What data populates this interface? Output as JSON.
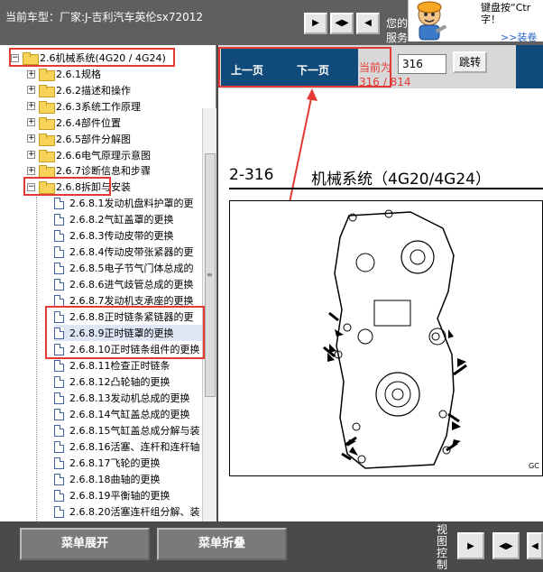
{
  "header": {
    "vehicle_label": "当前车型：厂家:J-吉利汽车英伦sx72012",
    "tip_text": "您的\n服务",
    "hint_text": "键盘按“Ctr\n字！",
    "hint_link": ">>装卷"
  },
  "tree": {
    "root": "2.6机械系统(4G20 / 4G24)",
    "sections": [
      {
        "label": "2.6.1规格"
      },
      {
        "label": "2.6.2描述和操作"
      },
      {
        "label": "2.6.3系统工作原理"
      },
      {
        "label": "2.6.4部件位置"
      },
      {
        "label": "2.6.5部件分解图"
      },
      {
        "label": "2.6.6电气原理示意图"
      },
      {
        "label": "2.6.7诊断信息和步骤"
      },
      {
        "label": "2.6.8拆卸与安装"
      }
    ],
    "items": [
      {
        "label": "2.6.8.1发动机盘料护罩的更"
      },
      {
        "label": "2.6.8.2气缸盖罩的更换"
      },
      {
        "label": "2.6.8.3传动皮带的更换"
      },
      {
        "label": "2.6.8.4传动皮带张紧器的更"
      },
      {
        "label": "2.6.8.5电子节气门体总成的"
      },
      {
        "label": "2.6.8.6进气歧管总成的更换"
      },
      {
        "label": "2.6.8.7发动机支承座的更换"
      },
      {
        "label": "2.6.8.8正时链条紧链器的更"
      },
      {
        "label": "2.6.8.9正时链罩的更换"
      },
      {
        "label": "2.6.8.10正时链条组件的更换"
      },
      {
        "label": "2.6.8.11检查正时链条"
      },
      {
        "label": "2.6.8.12凸轮轴的更换"
      },
      {
        "label": "2.6.8.13发动机总成的更换"
      },
      {
        "label": "2.6.8.14气缸盖总成的更换"
      },
      {
        "label": "2.6.8.15气缸盖总成分解与装"
      },
      {
        "label": "2.6.8.16活塞、连杆和连杆轴"
      },
      {
        "label": "2.6.8.17飞轮的更换"
      },
      {
        "label": "2.6.8.18曲轴的更换"
      },
      {
        "label": "2.6.8.19平衡轴的更换"
      },
      {
        "label": "2.6.8.20活塞连杆组分解、装"
      }
    ],
    "grip": "≡"
  },
  "pager": {
    "prev": "上一页",
    "next": "下一页",
    "current_label": "当前为",
    "current_value": "316 / 814",
    "page_input": "316",
    "goto": "跳转"
  },
  "document": {
    "page_num": "2-316",
    "title": "机械系统（4G20/4G24）",
    "figure_code": "GC"
  },
  "footer": {
    "expand": "菜单展开",
    "collapse": "菜单折叠",
    "view_control": "视图控制"
  },
  "colors": {
    "accent_red": "#e53935",
    "nav_blue": "#0f4a7a"
  }
}
